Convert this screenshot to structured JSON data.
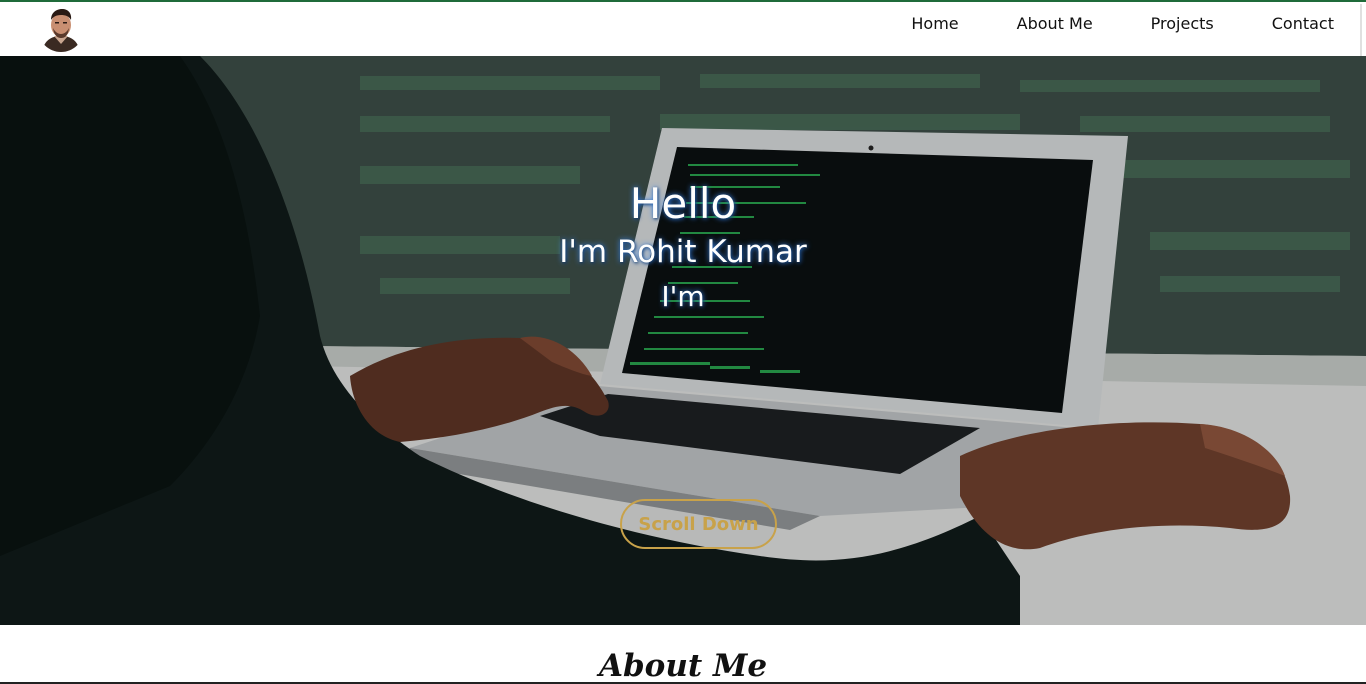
{
  "nav": {
    "links": [
      "Home",
      "About Me",
      "Projects",
      "Contact"
    ]
  },
  "hero": {
    "greeting": "Hello",
    "name_line": "I'm Rohit Kumar",
    "role_line": "I'm",
    "button_label": "Scroll Down"
  },
  "about": {
    "title": "About Me"
  },
  "colors": {
    "accent": "#c8a24a",
    "top_border": "#1f6b3a"
  }
}
